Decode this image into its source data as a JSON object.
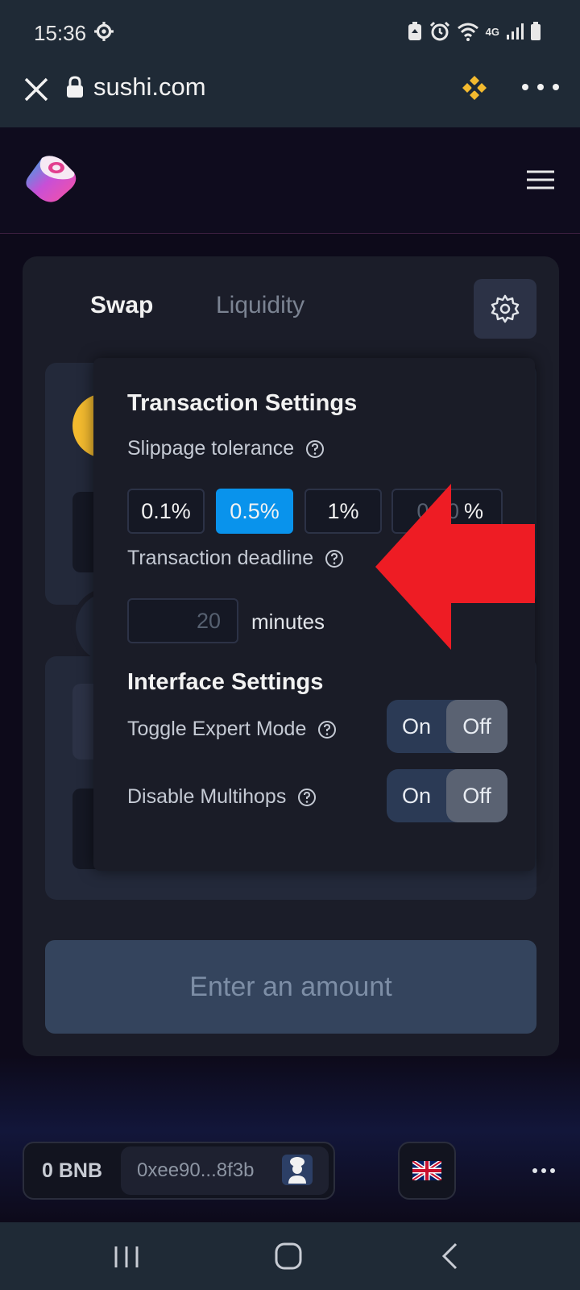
{
  "status_bar": {
    "time": "15:36",
    "network": "4G"
  },
  "browser": {
    "url": "sushi.com"
  },
  "swap": {
    "tabs": [
      "Swap",
      "Liquidity"
    ],
    "cta_label": "Enter an amount"
  },
  "settings": {
    "transaction_title": "Transaction Settings",
    "slippage_label": "Slippage tolerance",
    "slippage_options": [
      "0.1%",
      "0.5%",
      "1%"
    ],
    "slippage_selected": "0.5%",
    "custom_placeholder": "0.50",
    "custom_suffix": "%",
    "deadline_label": "Transaction deadline",
    "deadline_value": "20",
    "deadline_unit": "minutes",
    "interface_title": "Interface Settings",
    "expert_mode_label": "Toggle Expert Mode",
    "multihops_label": "Disable Multihops",
    "toggle_on": "On",
    "toggle_off": "Off",
    "expert_mode_state": "Off",
    "multihops_state": "Off"
  },
  "footer": {
    "balance": "0 BNB",
    "address": "0xee90...8f3b"
  },
  "icons": {
    "annotation_arrow_color": "#ee1c24",
    "accent_color": "#0993ec"
  }
}
